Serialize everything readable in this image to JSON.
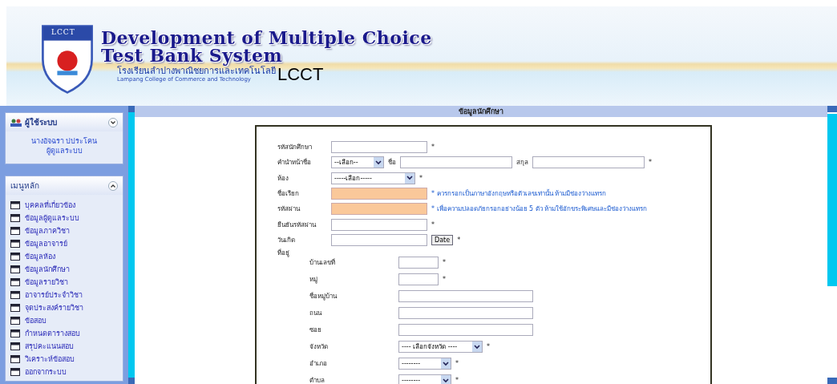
{
  "header": {
    "logo_text": "LCCT",
    "title_lines": [
      "Development of Multiple Choice",
      "Test Bank System"
    ],
    "school_thai": "โรงเรียนลำปางพาณิชยการและเทคโนโลยี",
    "school_english": "Lampang College of Commerce and Technology",
    "brand": "LCCT"
  },
  "sidebar": {
    "panels": [
      {
        "kind": "user",
        "title": "ผู้ใช้ระบบ",
        "lines": [
          "นางอัจฉรา ปประโคน",
          "ผู้ดูแลระบบ"
        ]
      },
      {
        "kind": "menu",
        "title": "เมนูหลัก",
        "items": [
          "บุคคลที่เกี่ยวข้อง",
          "ข้อมูลผู้ดูแลระบบ",
          "ข้อมูลภาควิชา",
          "ข้อมูลอาจารย์",
          "ข้อมูลห้อง",
          "ข้อมูลนักศึกษา",
          "ข้อมูลรายวิชา",
          "อาจารย์ประจำวิชา",
          "จุดประสงค์รายวิชา",
          "ข้อสอบ",
          "กำหนดตารางสอบ",
          "สรุปคะแนนสอบ",
          "วิเคราะห์ข้อสอบ",
          "ออกจากระบบ"
        ]
      }
    ]
  },
  "page_title": "ข้อมูลนักศึกษา",
  "form": {
    "rows": [
      {
        "label": "รหัสนักศึกษา",
        "controls": [
          {
            "kind": "input",
            "highlighted": false
          },
          {
            "kind": "text",
            "text": "*"
          }
        ]
      },
      {
        "label": "คำนำหน้าชื่อ",
        "controls": [
          {
            "kind": "shortselect",
            "value": "--เลือก--"
          },
          {
            "kind": "text",
            "text": "ชื่อ"
          },
          {
            "kind": "longinput",
            "highlighted": false
          },
          {
            "kind": "text",
            "text": "สกุล"
          },
          {
            "kind": "longinput",
            "highlighted": false
          },
          {
            "kind": "text",
            "text": "*"
          }
        ]
      },
      {
        "label": "ห้อง",
        "controls": [
          {
            "kind": "select",
            "value": "-----เลือก-----"
          },
          {
            "kind": "text",
            "text": "*"
          }
        ]
      },
      {
        "label": "ชื่อเรียก",
        "controls": [
          {
            "kind": "input",
            "highlighted": true
          },
          {
            "kind": "hint",
            "text": "* ควรกรอกเป็นภาษาอังกฤษหรือตัวเลขเท่านั้น ห้ามมีช่องว่างแทรก"
          }
        ]
      },
      {
        "label": "รหัสผ่าน",
        "controls": [
          {
            "kind": "input",
            "highlighted": true
          },
          {
            "kind": "hint",
            "text": "* เพื่อความปลอดภัยกรอกอย่างน้อย 5 ตัว ห้ามใช้อักขระพิเศษและมีช่องว่างแทรก"
          }
        ]
      },
      {
        "label": "ยืนยันรหัสผ่าน",
        "controls": [
          {
            "kind": "input",
            "highlighted": false
          },
          {
            "kind": "text",
            "text": "*"
          }
        ]
      },
      {
        "label": "วันเกิด",
        "controls": [
          {
            "kind": "input",
            "highlighted": false
          },
          {
            "kind": "button",
            "text": "Date"
          },
          {
            "kind": "text",
            "text": "*"
          }
        ]
      },
      {
        "label": "ที่อยู่",
        "controls": [],
        "children": [
          {
            "label": "บ้านเลขที่",
            "controls": [
              {
                "kind": "tinyinput",
                "highlighted": false
              },
              {
                "kind": "text",
                "text": "*"
              }
            ]
          },
          {
            "label": "หมู่",
            "controls": [
              {
                "kind": "tinyinput",
                "highlighted": false
              },
              {
                "kind": "text",
                "text": "*"
              }
            ]
          },
          {
            "label": "ชื่อหมู่บ้าน",
            "controls": [
              {
                "kind": "wideinput",
                "highlighted": false
              }
            ]
          },
          {
            "label": "ถนน",
            "controls": [
              {
                "kind": "wideinput",
                "highlighted": false
              }
            ]
          },
          {
            "label": "ซอย",
            "controls": [
              {
                "kind": "wideinput",
                "highlighted": false
              }
            ]
          },
          {
            "label": "จังหวัด",
            "controls": [
              {
                "kind": "select",
                "value": "---- เลือกจังหวัด ----"
              },
              {
                "kind": "text",
                "text": "*"
              }
            ]
          },
          {
            "label": "อำเภอ",
            "controls": [
              {
                "kind": "shortselect",
                "value": "--------"
              },
              {
                "kind": "text",
                "text": "*"
              }
            ]
          },
          {
            "label": "ตำบล",
            "controls": [
              {
                "kind": "shortselect",
                "value": "--------"
              },
              {
                "kind": "text",
                "text": "*"
              }
            ]
          }
        ]
      }
    ]
  }
}
